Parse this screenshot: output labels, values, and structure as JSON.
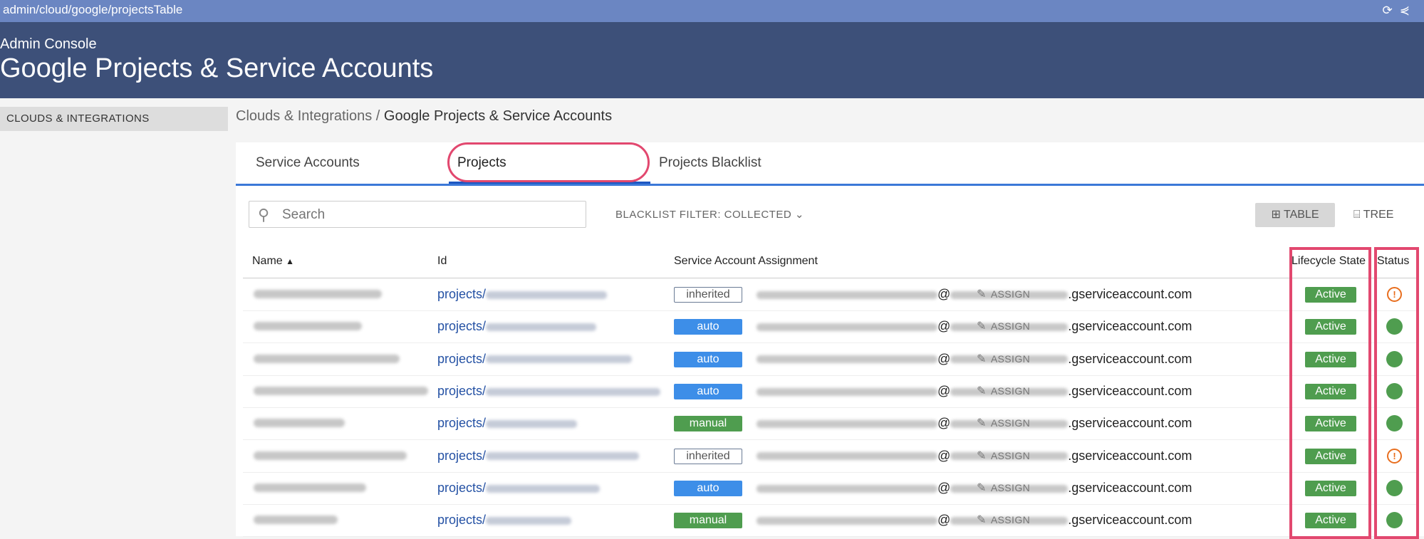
{
  "url_bar": {
    "url": "admin/cloud/google/projectsTable"
  },
  "header": {
    "subtitle": "Admin Console",
    "title": "Google Projects & Service Accounts"
  },
  "sidebar": {
    "items": [
      {
        "label": "CLOUDS & INTEGRATIONS"
      }
    ]
  },
  "breadcrumb": {
    "parent": "Clouds & Integrations",
    "separator": "/",
    "current": "Google Projects & Service Accounts"
  },
  "tabs": [
    {
      "label": "Service Accounts"
    },
    {
      "label": "Projects"
    },
    {
      "label": "Projects Blacklist"
    }
  ],
  "search": {
    "placeholder": "Search",
    "icon": "search-icon"
  },
  "filter": {
    "label": "BLACKLIST FILTER: COLLECTED"
  },
  "view_toggle": {
    "table": "TABLE",
    "tree": "TREE"
  },
  "table": {
    "columns": {
      "name": "Name",
      "id": "Id",
      "assignment": "Service Account Assignment",
      "lifecycle": "Lifecycle State",
      "status": "Status"
    },
    "id_prefix": "projects/",
    "email_at": "@",
    "email_suffix": ".gserviceaccount.com",
    "assign_label": "ASSIGN",
    "rows": [
      {
        "assignment": "inherited",
        "lifecycle": "Active",
        "status": "warning"
      },
      {
        "assignment": "auto",
        "lifecycle": "Active",
        "status": "ok"
      },
      {
        "assignment": "auto",
        "lifecycle": "Active",
        "status": "ok"
      },
      {
        "assignment": "auto",
        "lifecycle": "Active",
        "status": "ok"
      },
      {
        "assignment": "manual",
        "lifecycle": "Active",
        "status": "ok"
      },
      {
        "assignment": "inherited",
        "lifecycle": "Active",
        "status": "warning"
      },
      {
        "assignment": "auto",
        "lifecycle": "Active",
        "status": "ok"
      },
      {
        "assignment": "manual",
        "lifecycle": "Active",
        "status": "ok"
      }
    ]
  },
  "colors": {
    "header": "#3d5079",
    "url_bar": "#6b86c2",
    "highlight": "#e2486f",
    "active_green": "#4f9d4f",
    "auto_blue": "#3d8ee8",
    "warning": "#e86e1e"
  }
}
